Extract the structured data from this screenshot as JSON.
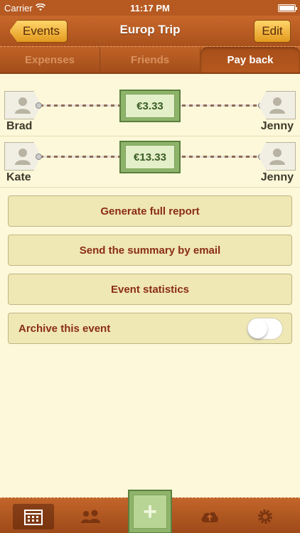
{
  "status_bar": {
    "carrier": "Carrier",
    "time": "11:17 PM"
  },
  "nav": {
    "back_label": "Events",
    "title": "Europ Trip",
    "edit_label": "Edit"
  },
  "tabs": [
    {
      "label": "Expenses",
      "active": false
    },
    {
      "label": "Friends",
      "active": false
    },
    {
      "label": "Pay back",
      "active": true
    }
  ],
  "paybacks": [
    {
      "from": "Brad",
      "to": "Jenny",
      "amount": "€3.33"
    },
    {
      "from": "Kate",
      "to": "Jenny",
      "amount": "€13.33"
    }
  ],
  "actions": {
    "report": "Generate full report",
    "email": "Send the summary by email",
    "stats": "Event statistics",
    "archive": "Archive this event",
    "archive_on": false
  },
  "tabbar": {
    "items": [
      "calendar-icon",
      "people-icon",
      "add-expense-icon",
      "cloud-upload-icon",
      "gear-icon"
    ],
    "active": "calendar-icon"
  },
  "colors": {
    "accent": "#b65a22",
    "button_text": "#8a2d17",
    "background": "#fdf8d9",
    "money_green": "#8eb36a"
  }
}
